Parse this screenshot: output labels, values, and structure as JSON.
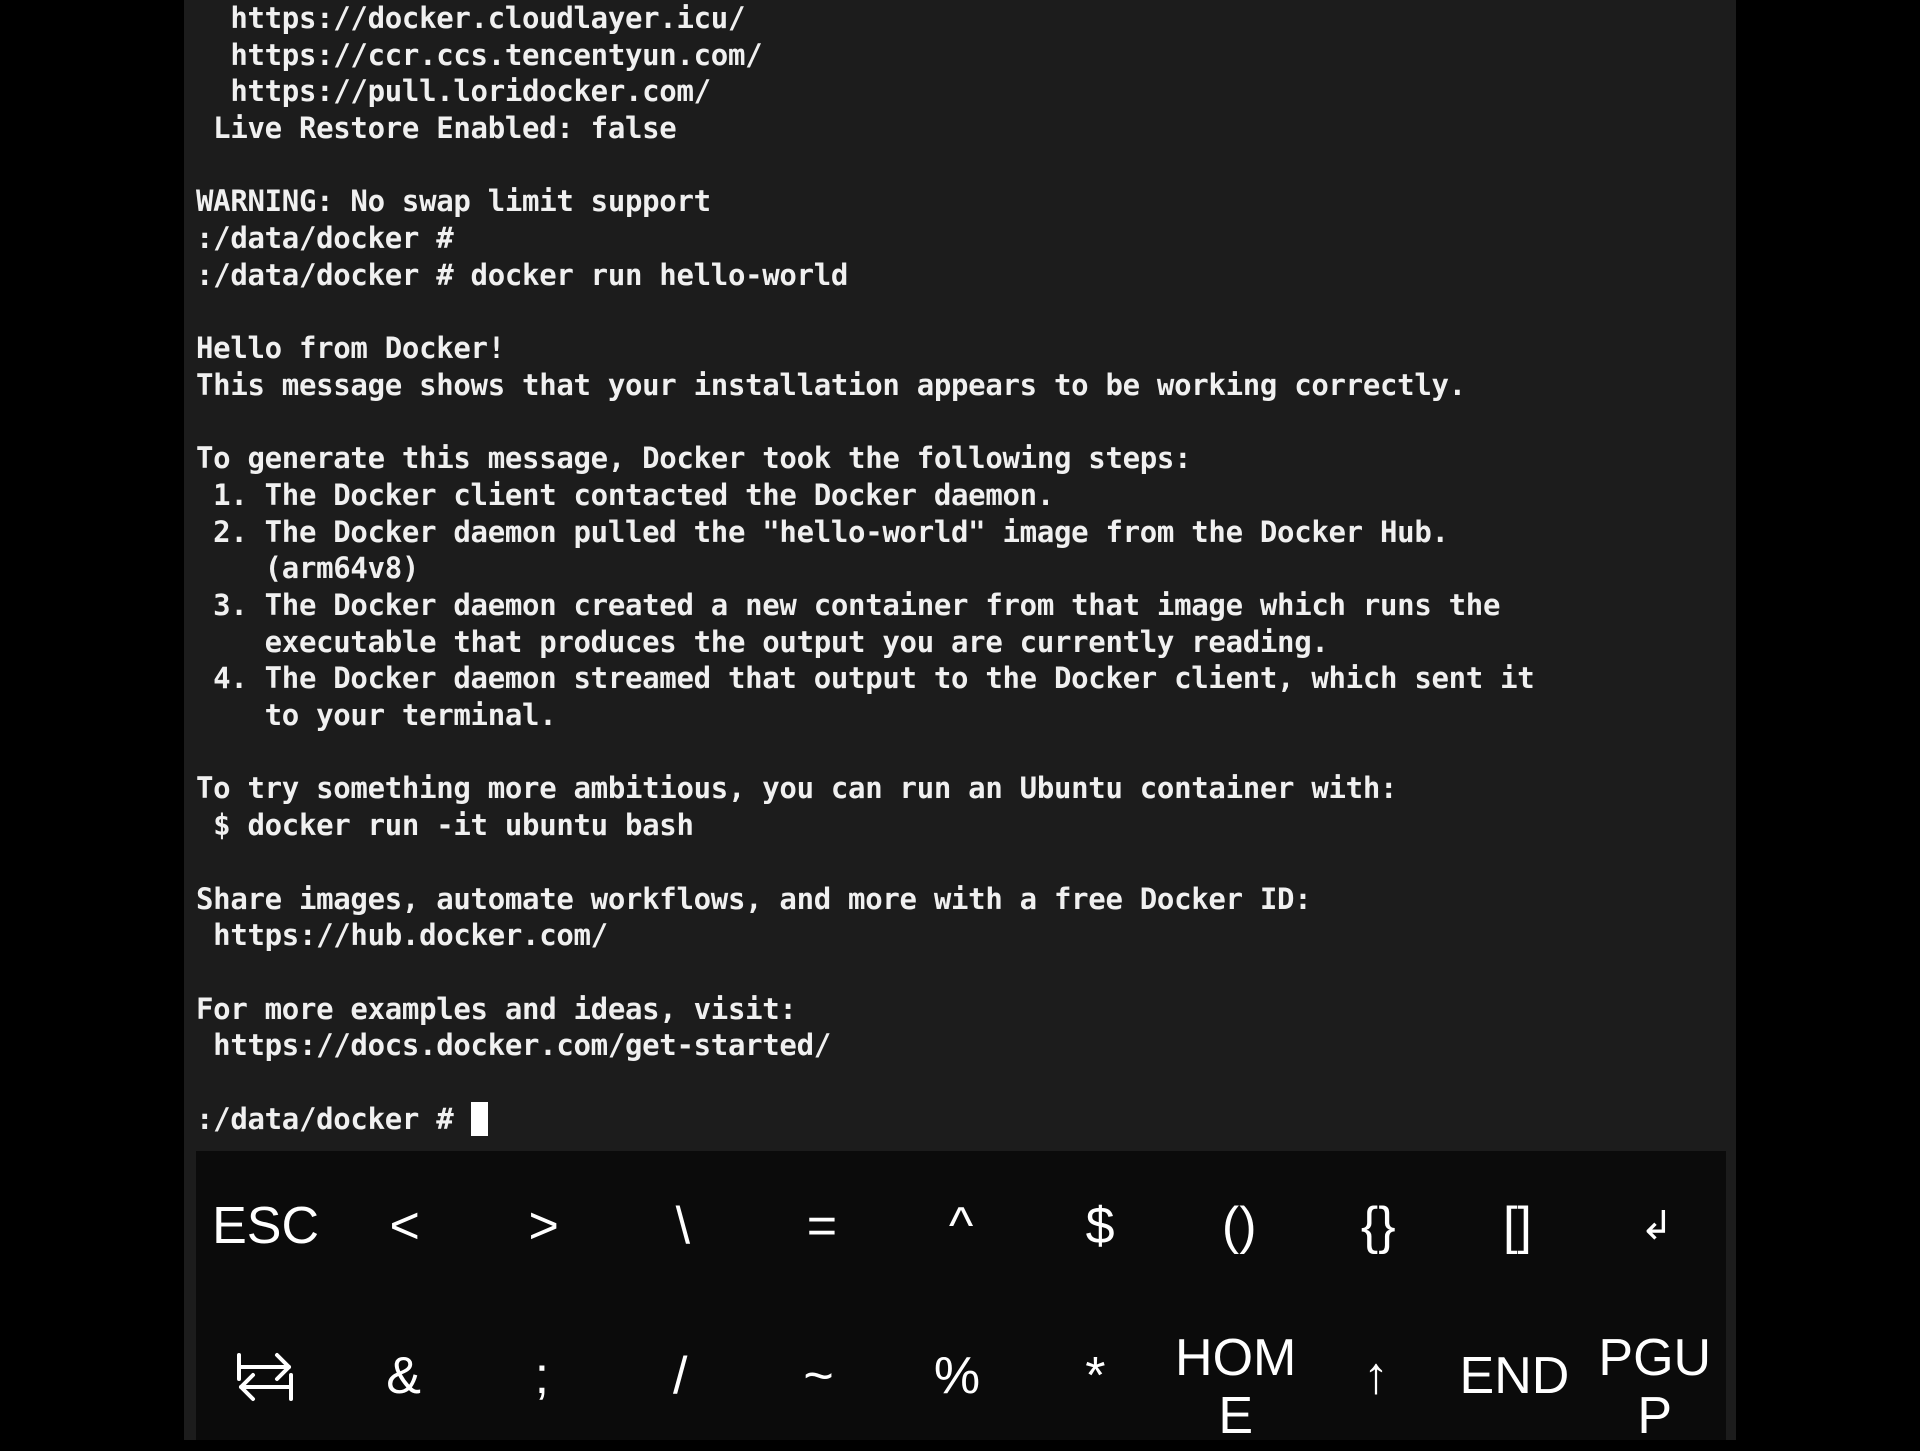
{
  "terminal": {
    "lines": [
      "  https://docker.cloudlayer.icu/",
      "  https://ccr.ccs.tencentyun.com/",
      "  https://pull.loridocker.com/",
      " Live Restore Enabled: false",
      "",
      "WARNING: No swap limit support",
      ":/data/docker #",
      ":/data/docker # docker run hello-world",
      "",
      "Hello from Docker!",
      "This message shows that your installation appears to be working correctly.",
      "",
      "To generate this message, Docker took the following steps:",
      " 1. The Docker client contacted the Docker daemon.",
      " 2. The Docker daemon pulled the \"hello-world\" image from the Docker Hub.",
      "    (arm64v8)",
      " 3. The Docker daemon created a new container from that image which runs the",
      "    executable that produces the output you are currently reading.",
      " 4. The Docker daemon streamed that output to the Docker client, which sent it",
      "    to your terminal.",
      "",
      "To try something more ambitious, you can run an Ubuntu container with:",
      " $ docker run -it ubuntu bash",
      "",
      "Share images, automate workflows, and more with a free Docker ID:",
      " https://hub.docker.com/",
      "",
      "For more examples and ideas, visit:",
      " https://docs.docker.com/get-started/",
      ""
    ],
    "prompt": ":/data/docker # "
  },
  "extra_keys": {
    "row1": {
      "esc": "ESC",
      "lt": "<",
      "gt": ">",
      "backslash": "\\",
      "equals": "=",
      "caret": "^",
      "dollar": "$",
      "parens": "()",
      "braces": "{}",
      "brackets": "[]",
      "enter": "↲"
    },
    "row2": {
      "tab_icon": "tab-arrows-icon",
      "ampersand": "&",
      "semicolon": ";",
      "slash": "/",
      "tilde": "~",
      "percent": "%",
      "asterisk": "*",
      "home": "HOME",
      "up": "↑",
      "end": "END",
      "pgup": "PGUP"
    }
  },
  "colors": {
    "terminal_bg": "#1c1c1c",
    "keys_bg": "#0b0b0b",
    "text": "#f0f0f0"
  }
}
